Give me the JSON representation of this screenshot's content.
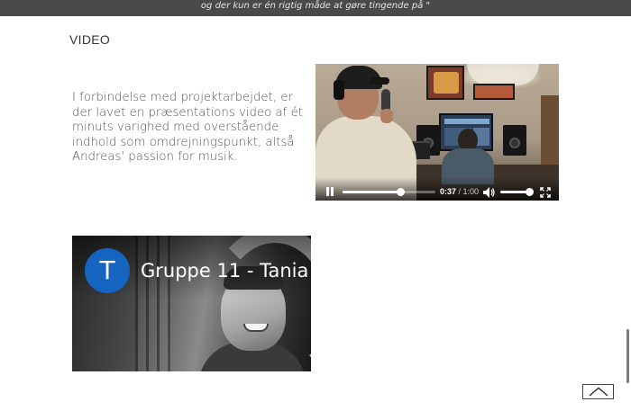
{
  "header": {
    "quote_text": "og der kun er én rigtig måde at gøre tingende på \""
  },
  "section": {
    "title": "VIDEO",
    "description": "I forbindelse med projektarbejdet, er der lavet en præsentations video af ét minuts varighed med overstående indhold som omdrejningspunkt, altså Andreas' passion for musik."
  },
  "player": {
    "current_time": "0:37",
    "separator": " / ",
    "duration": "1:00",
    "progress_fraction": 0.617,
    "volume_fraction": 0.9,
    "state": "playing",
    "icons": [
      "pause-icon",
      "volume-icon",
      "fullscreen-icon"
    ]
  },
  "youtube": {
    "avatar_letter": "T",
    "title": "Gruppe 11 - Tania",
    "avatar_color": "#1565c0"
  },
  "back_to_top": {
    "icon": "chevron-up-icon"
  },
  "colors": {
    "header_band": "#4a4947",
    "text": "#555555"
  }
}
